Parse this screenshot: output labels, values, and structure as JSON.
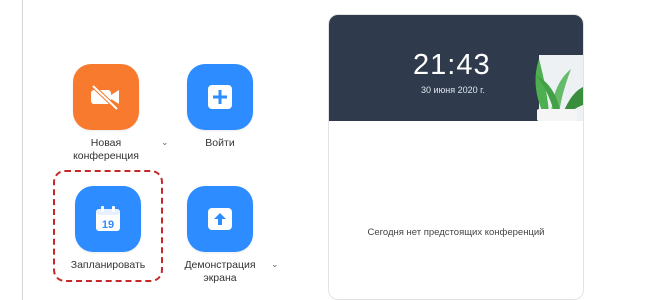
{
  "actions": {
    "new_meeting": {
      "label_line1": "Новая",
      "label_line2": "конференция",
      "icon": "video-off-icon",
      "color": "#f77a2e"
    },
    "join": {
      "label": "Войти",
      "icon": "plus-icon",
      "color": "#2d8cff"
    },
    "schedule": {
      "label": "Запланировать",
      "icon": "calendar-icon",
      "calendar_day": "19",
      "color": "#2d8cff"
    },
    "share_screen": {
      "label_line1": "Демонстрация",
      "label_line2": "экрана",
      "icon": "share-screen-icon",
      "color": "#2d8cff"
    }
  },
  "card": {
    "time": "21:43",
    "date": "30 июня 2020 г.",
    "empty_message": "Сегодня нет предстоящих конференций",
    "header_color": "#2f3b4c"
  },
  "caret_glyph": "⌄"
}
